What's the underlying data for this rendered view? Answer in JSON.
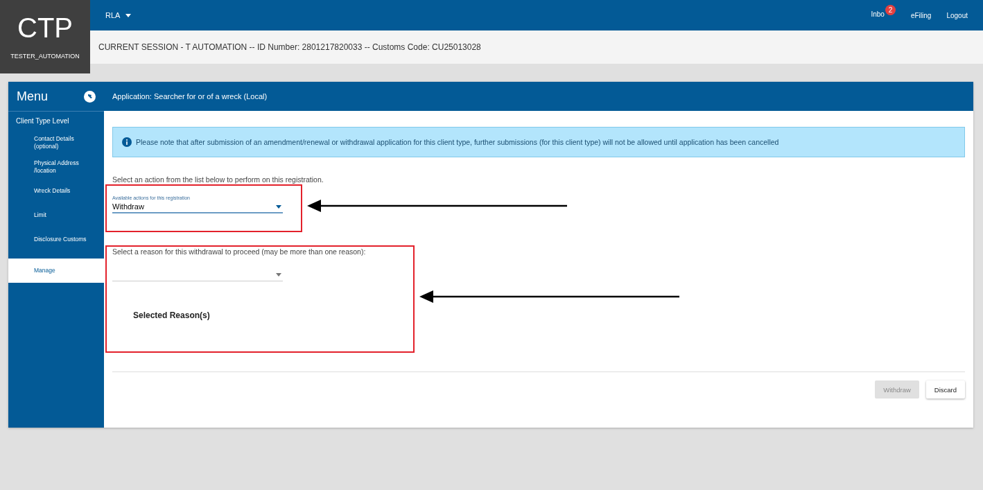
{
  "header": {
    "logo": "CTP",
    "user": "TESTER_AUTOMATION",
    "nav_menu": "RLA",
    "links": [
      {
        "label": "Inbo",
        "badge": "2"
      },
      {
        "label": "eFiling"
      },
      {
        "label": "Logout"
      }
    ],
    "session": "CURRENT SESSION - T AUTOMATION -- ID Number: 2801217820033 -- Customs Code: CU25013028"
  },
  "sidebar": {
    "title": "Menu",
    "section": {
      "label": "Client Type Level",
      "children": [
        {
          "label": "Contact Details (optional)",
          "selected": false
        },
        {
          "label": "Physical Address /location",
          "selected": false
        },
        {
          "label": "Wreck Details",
          "selected": false
        },
        {
          "label": "Limit",
          "selected": false
        },
        {
          "label": "Disclosure Customs",
          "selected": false
        },
        {
          "label": "Manage",
          "selected": true
        }
      ]
    }
  },
  "panel": {
    "title": "Application: Searcher for or of a wreck (Local)",
    "notice": "Please note that after submission of an amendment/renewal or withdrawal application for this client type, further submissions (for this client type) will not be allowed until application has been cancelled",
    "action_prompt": "Select an action from the list below to perform on this registration.",
    "action_select": {
      "label": "Available actions for this registration",
      "value": "Withdraw"
    },
    "reason_prompt": "Select a reason for this withdrawal to proceed (may be more than one reason):",
    "selected_heading": "Selected Reason(s)",
    "buttons": [
      {
        "label": "Withdraw",
        "disabled": true
      },
      {
        "label": "Discard",
        "disabled": false
      }
    ]
  }
}
